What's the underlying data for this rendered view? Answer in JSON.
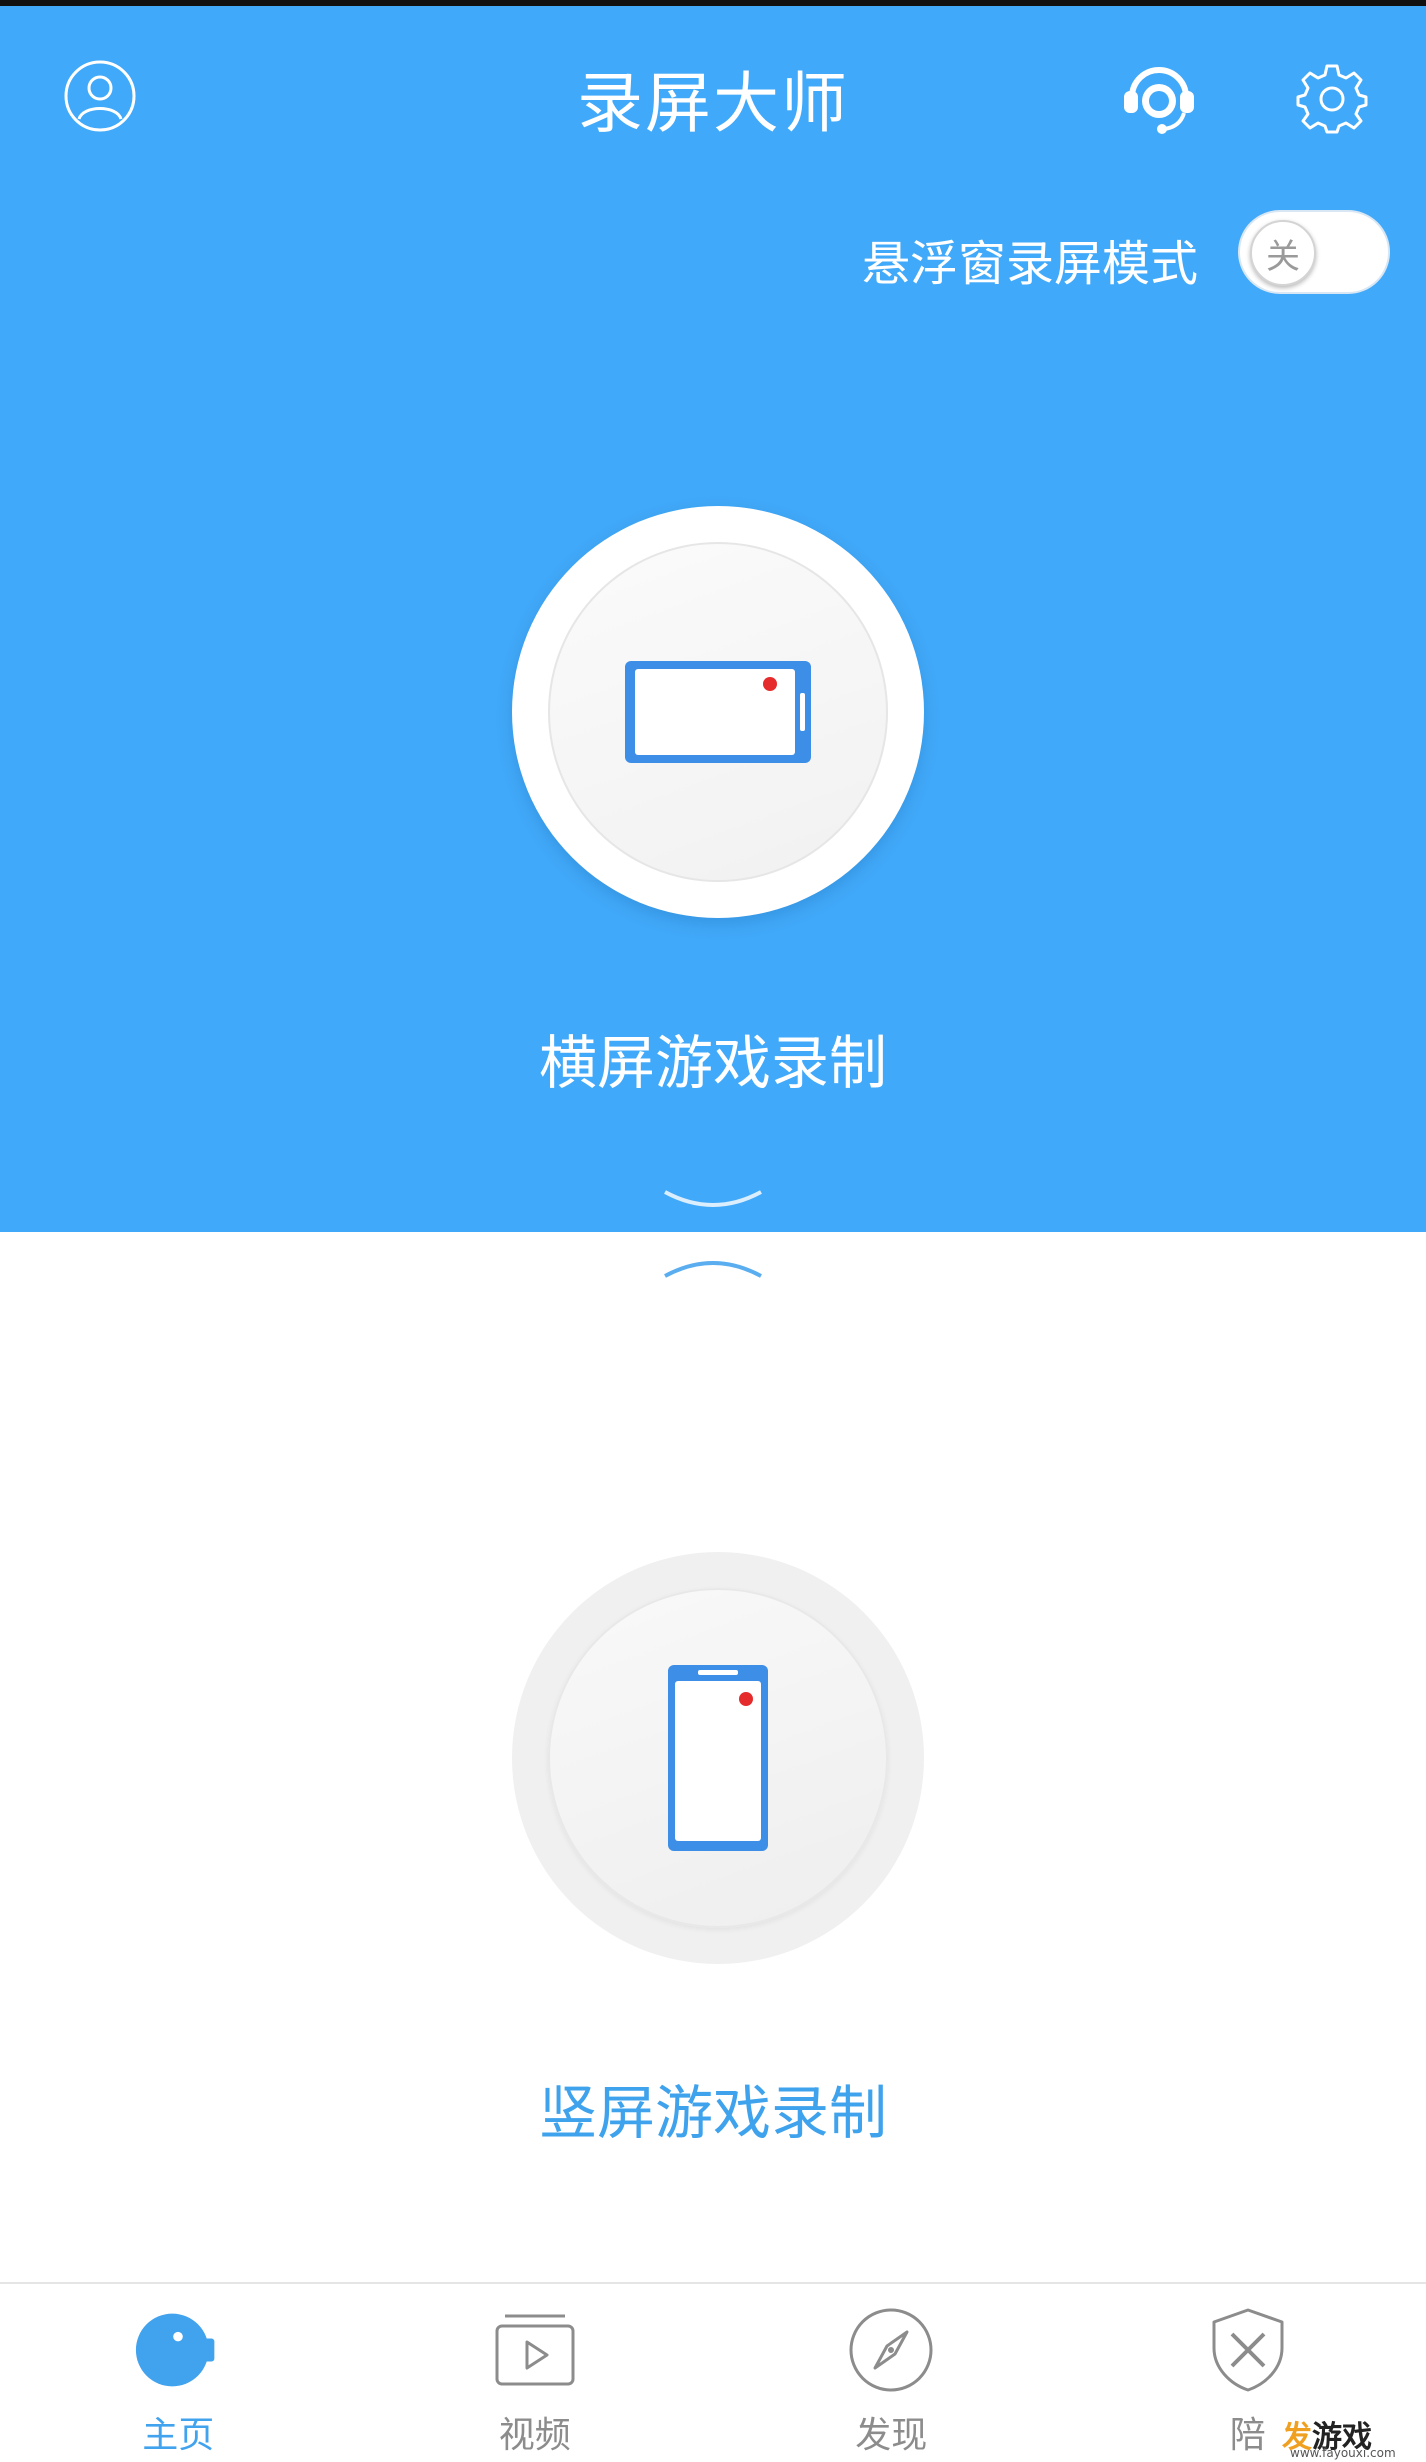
{
  "header": {
    "title": "录屏大师",
    "float_mode_label": "悬浮窗录屏模式",
    "float_toggle_text": "关",
    "float_toggle_on": false
  },
  "main": {
    "landscape_label": "横屏游戏录制",
    "portrait_label": "竖屏游戏录制"
  },
  "nav": {
    "tabs": [
      {
        "label": "主页",
        "icon": "camera-icon",
        "active": true
      },
      {
        "label": "视频",
        "icon": "video-play-icon",
        "active": false
      },
      {
        "label": "发现",
        "icon": "compass-icon",
        "active": false
      },
      {
        "label": "陪",
        "icon": "shield-swords-icon",
        "active": false
      }
    ]
  },
  "watermark": {
    "text_a": "发",
    "text_b": "游戏",
    "url": "www.fayouxi.com"
  },
  "colors": {
    "primary": "#41a9f9",
    "accent_text": "#3fa2ec",
    "record_dot": "#e52b2b",
    "tab_inactive": "#8c8c8c"
  }
}
